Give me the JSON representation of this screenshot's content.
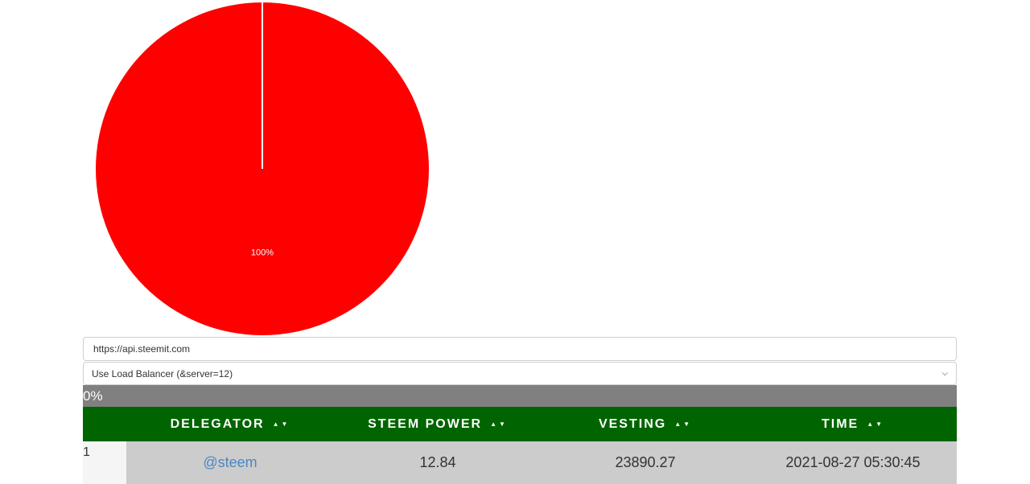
{
  "chart_data": {
    "type": "pie",
    "slices": [
      {
        "value": 100,
        "label": "100%",
        "color": "#ff0000"
      }
    ]
  },
  "server": {
    "url_value": "https://api.steemit.com",
    "selected_option": "Use Load Balancer (&server=12)"
  },
  "progress": {
    "label": "0%",
    "value": 0
  },
  "table": {
    "columns": [
      "DELEGATOR",
      "STEEM POWER",
      "VESTING",
      "TIME"
    ],
    "sort_glyph": "▲▼",
    "rows": [
      {
        "index": "1",
        "delegator": "@steem",
        "steem_power": "12.84",
        "vesting": "23890.27",
        "time": "2021-08-27 05:30:45"
      }
    ]
  }
}
